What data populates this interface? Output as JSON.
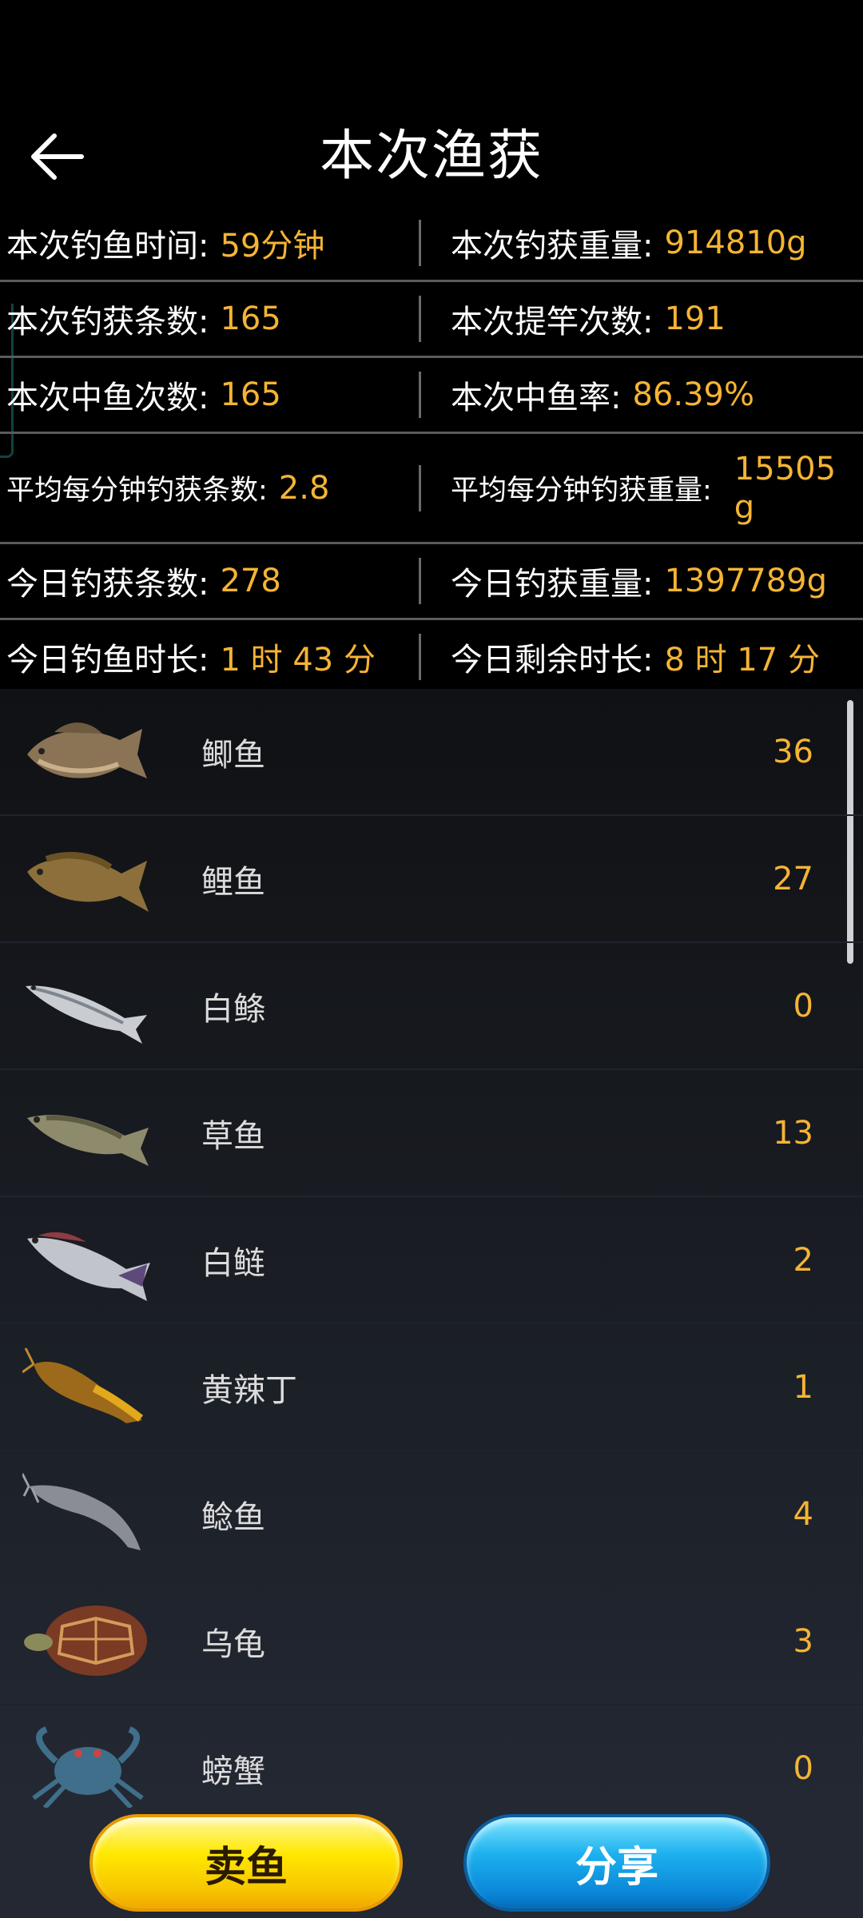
{
  "header": {
    "title": "本次渔获"
  },
  "stats": [
    {
      "left": {
        "label": "本次钓鱼时间:",
        "value": "59分钟"
      },
      "right": {
        "label": "本次钓获重量:",
        "value": "914810g"
      }
    },
    {
      "left": {
        "label": "本次钓获条数:",
        "value": "165"
      },
      "right": {
        "label": "本次提竿次数:",
        "value": "191"
      }
    },
    {
      "left": {
        "label": "本次中鱼次数:",
        "value": "165"
      },
      "right": {
        "label": "本次中鱼率:",
        "value": "86.39%"
      }
    },
    {
      "left": {
        "label": "平均每分钟钓获条数:",
        "value": "2.8"
      },
      "right": {
        "label": "平均每分钟钓获重量:",
        "value": "15505g"
      }
    },
    {
      "left": {
        "label": "今日钓获条数:",
        "value": "278"
      },
      "right": {
        "label": "今日钓获重量:",
        "value": "1397789g"
      }
    },
    {
      "left": {
        "label": "今日钓鱼时长:",
        "value": "1 时 43 分"
      },
      "right": {
        "label": "今日剩余时长:",
        "value": "8 时 17 分"
      }
    }
  ],
  "catches": [
    {
      "name": "鲫鱼",
      "count": "36",
      "icon": "crucian-carp-icon"
    },
    {
      "name": "鲤鱼",
      "count": "27",
      "icon": "carp-icon"
    },
    {
      "name": "白鲦",
      "count": "0",
      "icon": "white-minnow-icon"
    },
    {
      "name": "草鱼",
      "count": "13",
      "icon": "grass-carp-icon"
    },
    {
      "name": "白鲢",
      "count": "2",
      "icon": "silver-carp-icon"
    },
    {
      "name": "黄辣丁",
      "count": "1",
      "icon": "yellow-catfish-icon"
    },
    {
      "name": "鲶鱼",
      "count": "4",
      "icon": "catfish-icon"
    },
    {
      "name": "乌龟",
      "count": "3",
      "icon": "turtle-icon"
    },
    {
      "name": "螃蟹",
      "count": "0",
      "icon": "crab-icon"
    }
  ],
  "actions": {
    "sell_label": "卖鱼",
    "share_label": "分享"
  },
  "colors": {
    "accent_value": "#f5b434",
    "sell_button": "#ffe800",
    "share_button": "#1db1ef"
  }
}
